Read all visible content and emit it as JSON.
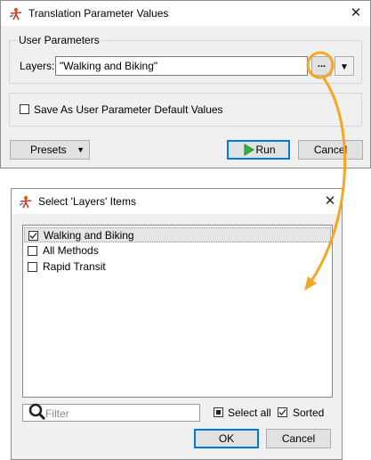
{
  "top_dialog": {
    "title": "Translation Parameter Values",
    "close_glyph": "✕",
    "group_title": "User Parameters",
    "layers_label": "Layers:",
    "layers_value": "\"Walking and Biking\"",
    "browse_label": "...",
    "dropdown_glyph": "▼",
    "save_default_label": "Save As User Parameter Default Values",
    "save_default_checked": false,
    "presets_label": "Presets",
    "presets_arrow": "▼",
    "run_label": "Run",
    "cancel_label": "Cancel"
  },
  "select_dialog": {
    "title": "Select 'Layers' Items",
    "close_glyph": "✕",
    "items": [
      {
        "label": "Walking and Biking",
        "checked": true,
        "selected": true
      },
      {
        "label": "All Methods",
        "checked": false,
        "selected": false
      },
      {
        "label": "Rapid Transit",
        "checked": false,
        "selected": false
      }
    ],
    "filter_placeholder": "Filter",
    "select_all_label": "Select all",
    "sorted_label": "Sorted",
    "sorted_checked": true,
    "ok_label": "OK",
    "cancel_label": "Cancel"
  },
  "colors": {
    "annotation_orange": "#f5a623",
    "run_green": "#3cb043",
    "focus_blue": "#0078d7"
  }
}
